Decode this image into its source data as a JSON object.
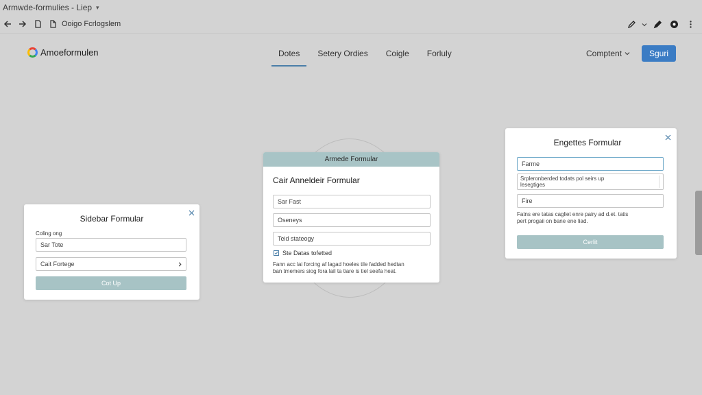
{
  "browser": {
    "tab_title": "Armwde-formulies - Liep",
    "url": "Ooigo Fcrlogslem"
  },
  "header": {
    "brand": "Amoeformulen",
    "nav": [
      "Dotes",
      "Setery Ordies",
      "Coigle",
      "Forluly"
    ],
    "active_nav": "Dotes",
    "compliment": "Comptent",
    "signin": "Sguri"
  },
  "sidebar_card": {
    "title": "Sidebar Formular",
    "label": "Coling ong",
    "field1": "Sar Tote",
    "field2": "Cait Fortege",
    "button": "Cot Up"
  },
  "center_card": {
    "header": "Armede Formular",
    "title": "Cair Anneldeir Formular",
    "field1": "Sar Fast",
    "field2": "Oseneys",
    "field3": "Teid stateogy",
    "checkbox_label": "Ste Datas tofetted",
    "note_line1": "Fann acc lai forcing af lagad hoeles tile fadded hedtan",
    "note_line2": "ban tmemers siog fora lail ta tiare is tiel seefa heat."
  },
  "right_card": {
    "title": "Engettes Formular",
    "field1": "Farme",
    "textarea_line1": "Srpleronberded todats pol seirs up",
    "textarea_line2": "lesegtiges",
    "field3": "Fire",
    "note_line1": "Fatns ere tatas cagliet enre pairy ad d.et. tatis",
    "note_line2": "pert progaii on bane ene liad.",
    "button": "Cerlit"
  },
  "colors": {
    "accent_blue": "#3b7cc4",
    "teal": "#a7c3c5",
    "page_bg": "#d3d3d3"
  }
}
